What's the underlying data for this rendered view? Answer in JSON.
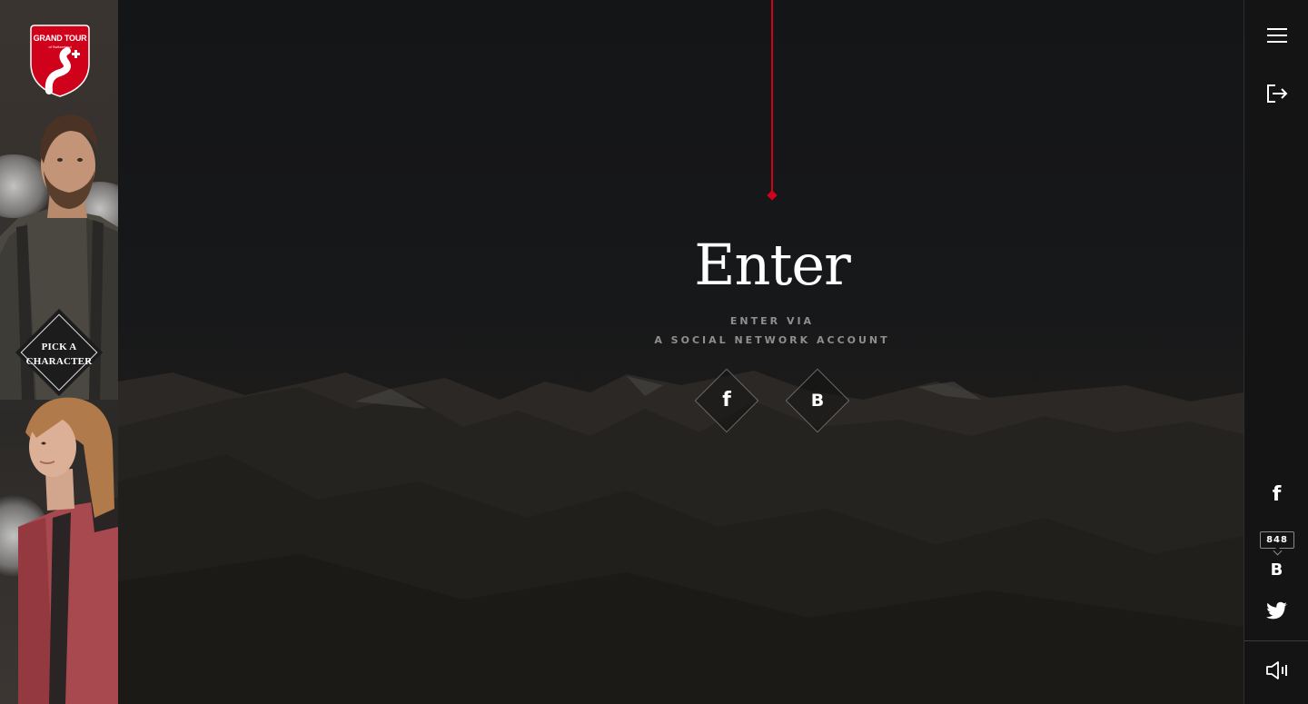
{
  "brand": {
    "title": "GRAND TOUR",
    "subtitle": "of Switzerland",
    "accent_color": "#d0021b"
  },
  "characters": {
    "pick_label": "PICK A CHARACTER"
  },
  "hero": {
    "title": "Enter",
    "subtitle_line1": "ENTER VIA",
    "subtitle_line2": "A SOCIAL NETWORK ACCOUNT"
  },
  "login_buttons": [
    {
      "glyph": "f",
      "icon": "facebook-icon"
    },
    {
      "glyph": "B",
      "icon": "vk-icon"
    }
  ],
  "right_rail": {
    "menu_icon": "hamburger-menu-icon",
    "logout_icon": "logout-icon",
    "share": {
      "facebook_glyph": "f",
      "vk_glyph": "B",
      "vk_count": "848",
      "twitter_icon": "twitter-icon"
    },
    "sound_icon": "speaker-icon"
  }
}
